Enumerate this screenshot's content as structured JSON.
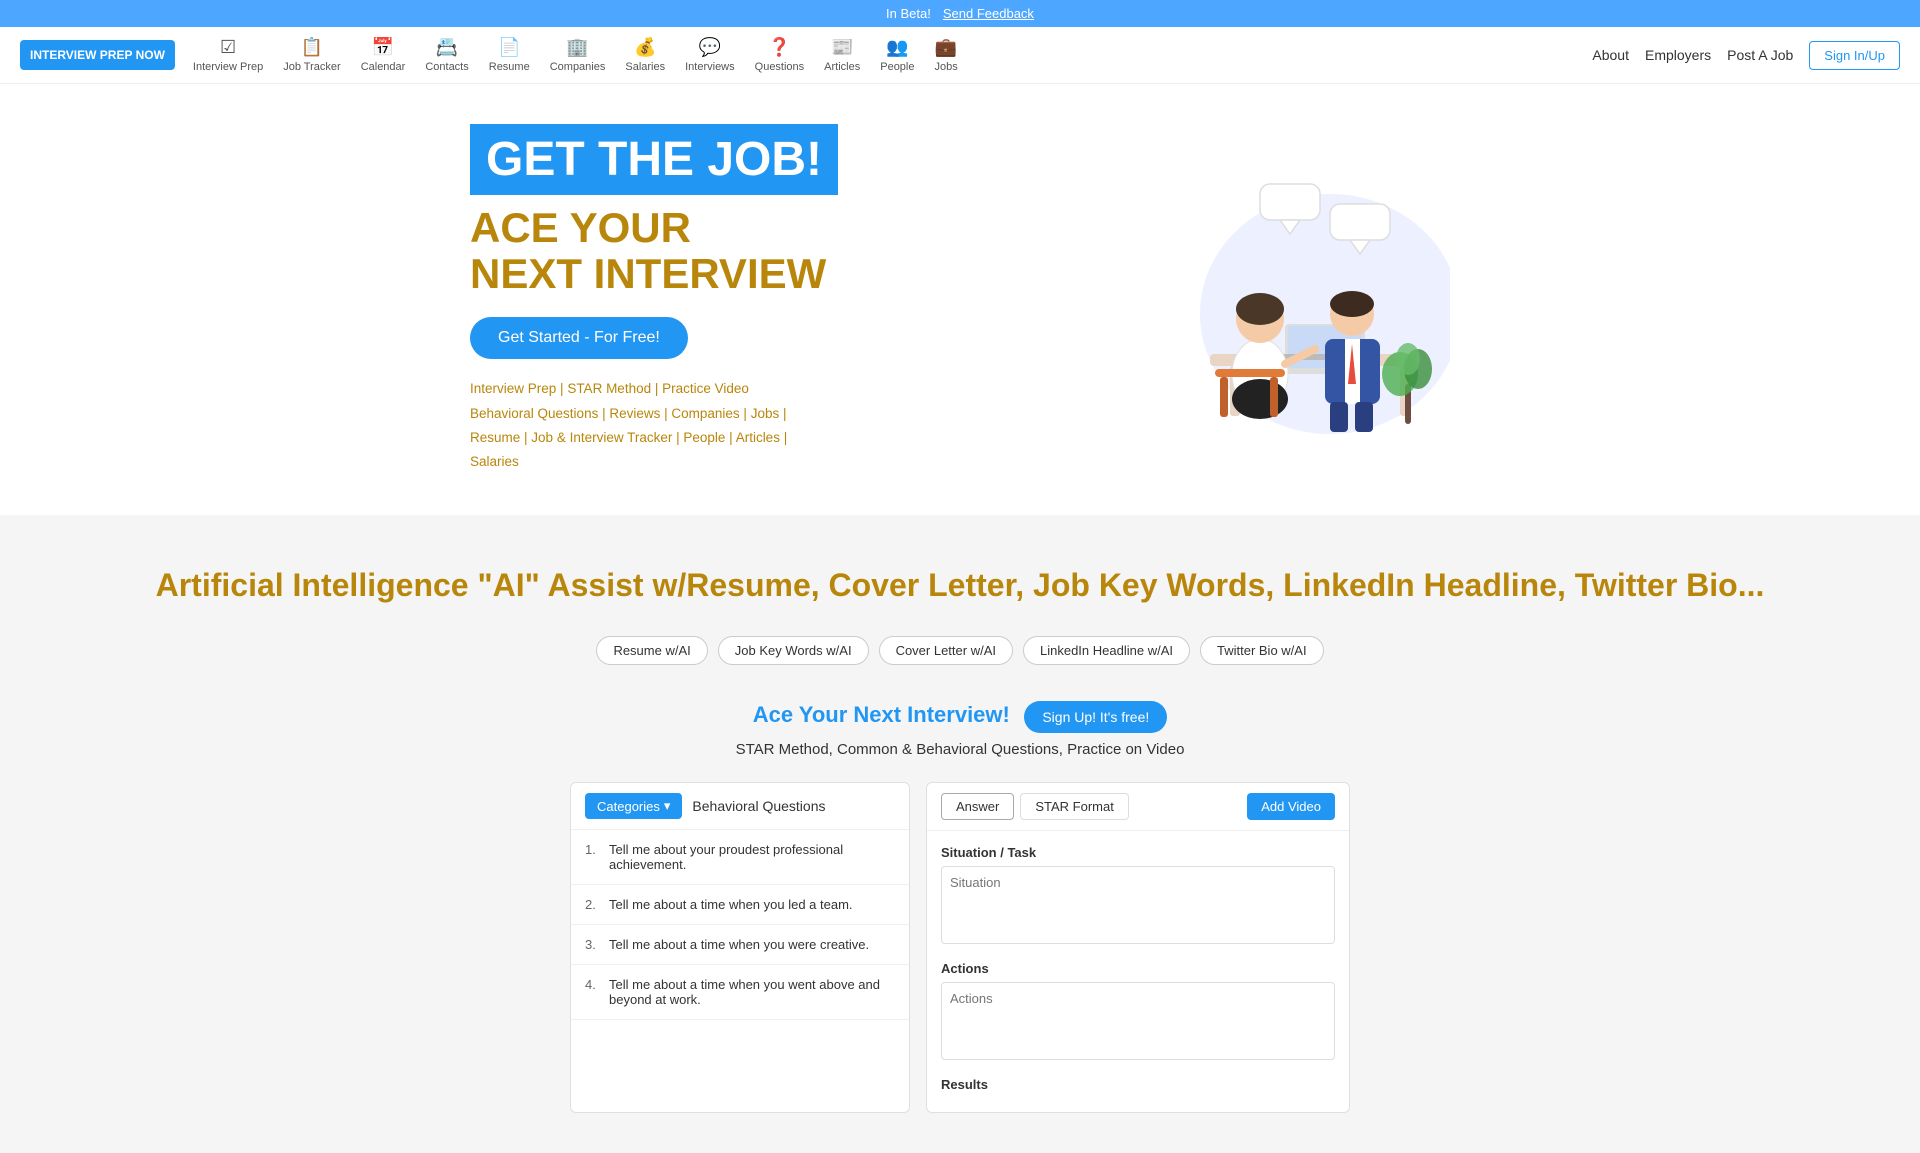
{
  "beta_banner": {
    "text": "In Beta!",
    "feedback_label": "Send Feedback"
  },
  "nav": {
    "logo": "INTERVIEW PREP NOW",
    "items": [
      {
        "id": "interview-prep",
        "label": "Interview Prep",
        "icon": "☑"
      },
      {
        "id": "job-tracker",
        "label": "Job Tracker",
        "icon": "📋"
      },
      {
        "id": "calendar",
        "label": "Calendar",
        "icon": "📅"
      },
      {
        "id": "contacts",
        "label": "Contacts",
        "icon": "📇"
      },
      {
        "id": "resume",
        "label": "Resume",
        "icon": "📄"
      },
      {
        "id": "companies",
        "label": "Companies",
        "icon": "🏢"
      },
      {
        "id": "salaries",
        "label": "Salaries",
        "icon": "💰"
      },
      {
        "id": "interviews",
        "label": "Interviews",
        "icon": "💬"
      },
      {
        "id": "questions",
        "label": "Questions",
        "icon": "❓"
      },
      {
        "id": "articles",
        "label": "Articles",
        "icon": "📰"
      },
      {
        "id": "people",
        "label": "People",
        "icon": "👥"
      },
      {
        "id": "jobs",
        "label": "Jobs",
        "icon": "💼"
      }
    ],
    "right_links": [
      "About",
      "Employers",
      "Post A Job"
    ],
    "signin_label": "Sign In/Up"
  },
  "hero": {
    "headline": "GET THE JOB!",
    "subheadline_line1": "ACE YOUR",
    "subheadline_line2": "NEXT INTERVIEW",
    "cta_label": "Get Started - For Free!",
    "links_line1": "Interview Prep | STAR Method | Practice Video | Behavioral Questions | Reviews | Companies | Jobs |",
    "links_line2": "Resume | Job & Interview Tracker | People | Articles | Salaries"
  },
  "gray_section": {
    "ai_headline": "Artificial Intelligence \"AI\" Assist w/Resume, Cover Letter, Job Key Words, LinkedIn Headline, Twitter Bio...",
    "chips": [
      "Resume w/AI",
      "Job Key Words w/AI",
      "Cover Letter w/AI",
      "LinkedIn Headline w/AI",
      "Twitter Bio w/AI"
    ],
    "ace_title": "Ace Your Next Interview!",
    "signup_label": "Sign Up! It's free!",
    "ace_subtitle": "STAR Method, Common & Behavioral Questions, Practice on Video"
  },
  "left_panel": {
    "categories_label": "Categories",
    "panel_title": "Behavioral Questions",
    "questions": [
      {
        "num": "1.",
        "text": "Tell me about your proudest professional achievement."
      },
      {
        "num": "2.",
        "text": "Tell me about a time when you led a team."
      },
      {
        "num": "3.",
        "text": "Tell me about a time when you were creative."
      },
      {
        "num": "4.",
        "text": "Tell me about a time when you went above and beyond at work."
      }
    ]
  },
  "right_panel": {
    "tab_answer": "Answer",
    "tab_star": "STAR Format",
    "add_video_label": "Add Video",
    "situation_label": "Situation / Task",
    "situation_placeholder": "Situation",
    "actions_label": "Actions",
    "actions_placeholder": "Actions",
    "results_label": "Results"
  },
  "colors": {
    "blue": "#2196F3",
    "gold": "#b8860b",
    "beta_blue": "#4da6ff"
  }
}
